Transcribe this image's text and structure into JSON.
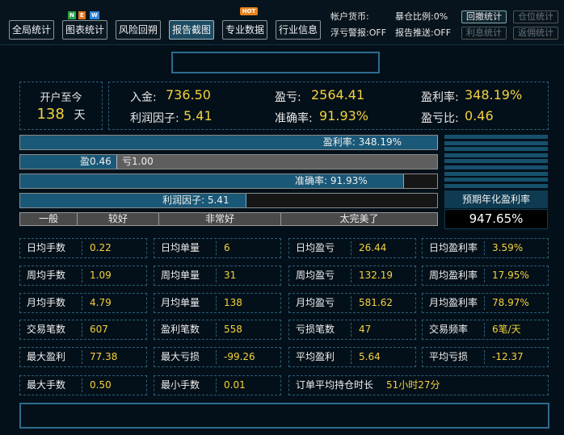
{
  "tabs": [
    {
      "label": "全局统计"
    },
    {
      "label": "图表统计",
      "badge": "NEW"
    },
    {
      "label": "风险回朔"
    },
    {
      "label": "报告截图",
      "active": true
    },
    {
      "label": "专业数据",
      "badge": "HOT"
    },
    {
      "label": "行业信息"
    }
  ],
  "right_info": {
    "account_currency": "帐户货币:",
    "margin_ratio": "暴仓比例:0%",
    "float_alert": "浮亏警报:OFF",
    "report_push": "报告推送:OFF",
    "buttons": [
      {
        "label": "回撤统计",
        "enabled": true
      },
      {
        "label": "仓位统计",
        "enabled": false
      },
      {
        "label": "利息统计",
        "enabled": false
      },
      {
        "label": "返佣统计",
        "enabled": false
      }
    ]
  },
  "summary": {
    "since_open_label": "开户至今",
    "days_value": "138",
    "days_unit": "天",
    "deposit_label": "入金:",
    "deposit_value": "736.50",
    "profit_label": "盈亏:",
    "profit_value": "2564.41",
    "profit_rate_label": "盈利率:",
    "profit_rate_value": "348.19%",
    "profit_factor_label": "利润因子:",
    "profit_factor_value": "5.41",
    "accuracy_label": "准确率:",
    "accuracy_value": "91.93%",
    "pl_ratio_label": "盈亏比:",
    "pl_ratio_value": "0.46"
  },
  "bars": {
    "profit_rate": {
      "text": "盈利率: 348.19%",
      "fraction": 1.0
    },
    "profit_loss": {
      "win_text": "盈0.46",
      "loss_text": "亏1.00",
      "fraction": 0.23
    },
    "accuracy": {
      "text": "准确率: 91.93%",
      "fraction": 0.9193
    },
    "profit_factor": {
      "text": "利润因子: 5.41",
      "fraction": 0.54
    }
  },
  "ratings": [
    "一般",
    "较好",
    "非常好",
    "太完美了"
  ],
  "annualized": {
    "label": "预期年化盈利率",
    "value": "947.65%"
  },
  "stats": [
    [
      {
        "k": "日均手数",
        "v": "0.22"
      },
      {
        "k": "日均单量",
        "v": "6"
      },
      {
        "k": "日均盈亏",
        "v": "26.44"
      },
      {
        "k": "日均盈利率",
        "v": "3.59%"
      }
    ],
    [
      {
        "k": "周均手数",
        "v": "1.09"
      },
      {
        "k": "周均单量",
        "v": "31"
      },
      {
        "k": "周均盈亏",
        "v": "132.19"
      },
      {
        "k": "周均盈利率",
        "v": "17.95%"
      }
    ],
    [
      {
        "k": "月均手数",
        "v": "4.79"
      },
      {
        "k": "月均单量",
        "v": "138"
      },
      {
        "k": "月均盈亏",
        "v": "581.62"
      },
      {
        "k": "月均盈利率",
        "v": "78.97%"
      }
    ],
    [
      {
        "k": "交易笔数",
        "v": "607"
      },
      {
        "k": "盈利笔数",
        "v": "558"
      },
      {
        "k": "亏损笔数",
        "v": "47"
      },
      {
        "k": "交易频率",
        "v": "6笔/天"
      }
    ],
    [
      {
        "k": "最大盈利",
        "v": "77.38"
      },
      {
        "k": "最大亏损",
        "v": "-99.26"
      },
      {
        "k": "平均盈利",
        "v": "5.64"
      },
      {
        "k": "平均亏损",
        "v": "-12.37"
      }
    ],
    [
      {
        "k": "最大手数",
        "v": "0.50"
      },
      {
        "k": "最小手数",
        "v": "0.01"
      }
    ]
  ],
  "hold_time": {
    "label": "订单平均持仓时长",
    "value": "51小时27分"
  }
}
